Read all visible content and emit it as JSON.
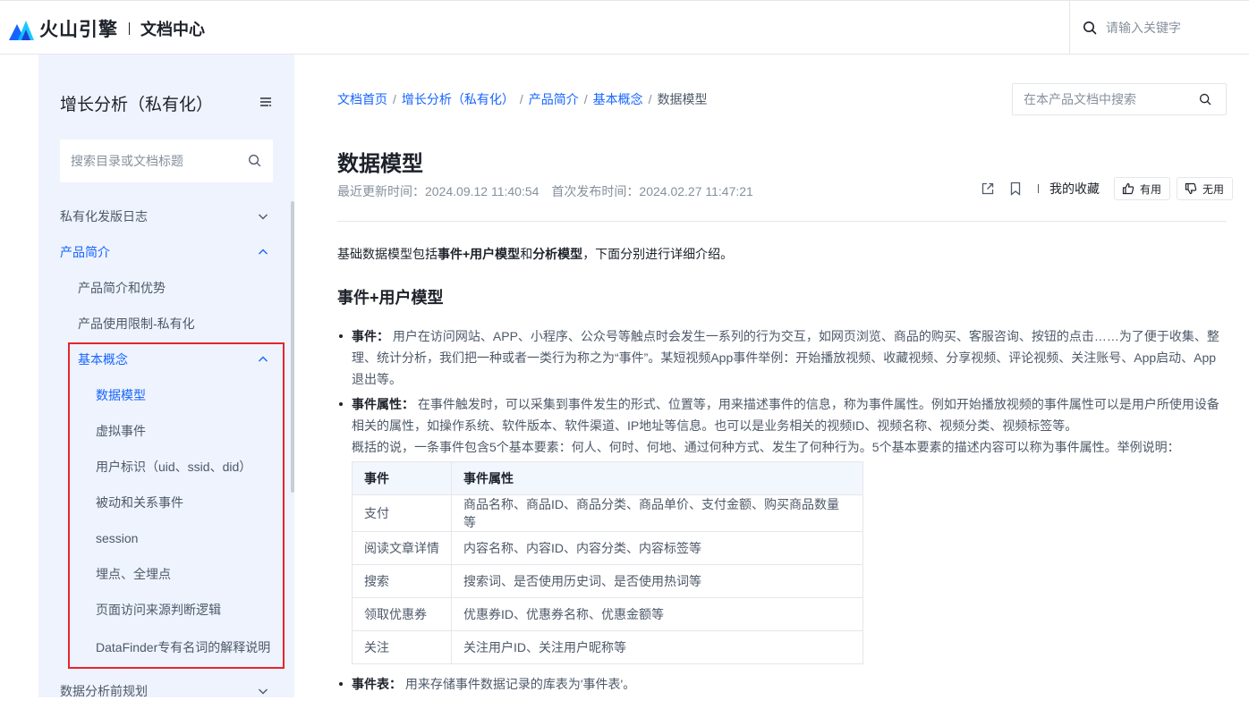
{
  "header": {
    "brand": "火山引擎",
    "section": "文档中心",
    "search_placeholder": "请输入关键字"
  },
  "sidebar": {
    "title": "增长分析（私有化）",
    "search_placeholder": "搜索目录或文档标题",
    "items": [
      {
        "label": "私有化发版日志"
      },
      {
        "label": "产品简介"
      },
      {
        "label": "产品简介和优势"
      },
      {
        "label": "产品使用限制-私有化"
      },
      {
        "label": "基本概念"
      },
      {
        "label": "数据模型"
      },
      {
        "label": "虚拟事件"
      },
      {
        "label": "用户标识（uid、ssid、did）"
      },
      {
        "label": "被动和关系事件"
      },
      {
        "label": "session"
      },
      {
        "label": "埋点、全埋点"
      },
      {
        "label": "页面访问来源判断逻辑"
      },
      {
        "label": "DataFinder专有名词的解释说明"
      },
      {
        "label": "数据分析前规划"
      }
    ]
  },
  "breadcrumb": {
    "items": [
      "文档首页",
      "增长分析（私有化）",
      "产品简介",
      "基本概念"
    ],
    "current": "数据模型"
  },
  "content_search_placeholder": "在本产品文档中搜索",
  "article": {
    "title": "数据模型",
    "updated": "最近更新时间：2024.09.12 11:40:54",
    "published": "首次发布时间：2024.02.27 11:47:21",
    "favorite_label": "我的收藏",
    "useful_label": "有用",
    "useless_label": "无用",
    "intro_prefix": "基础数据模型包括",
    "intro_bold1": "事件+用户模型",
    "intro_mid": "和",
    "intro_bold2": "分析模型",
    "intro_suffix": "，下面分别进行详细介绍。",
    "section_heading": "事件+用户模型",
    "bullet1_term": "事件：",
    "bullet1_text": " 用户在访问网站、APP、小程序、公众号等触点时会发生一系列的行为交互，如网页浏览、商品的购买、客服咨询、按钮的点击……为了便于收集、整理、统计分析，我们把一种或者一类行为称之为“事件”。某短视频App事件举例：开始播放视频、收藏视频、分享视频、评论视频、关注账号、App启动、App退出等。",
    "bullet2_term": "事件属性：",
    "bullet2_text": " 在事件触发时，可以采集到事件发生的形式、位置等，用来描述事件的信息，称为事件属性。例如开始播放视频的事件属性可以是用户所使用设备相关的属性，如操作系统、软件版本、软件渠道、IP地址等信息。也可以是业务相关的视频ID、视频名称、视频分类、视频标签等。",
    "bullet2_extra": "概括的说，一条事件包含5个基本要素：何人、何时、何地、通过何种方式、发生了何种行为。5个基本要素的描述内容可以称为事件属性。举例说明：",
    "table": {
      "headers": [
        "事件",
        "事件属性"
      ],
      "rows": [
        [
          "支付",
          "商品名称、商品ID、商品分类、商品单价、支付金额、购买商品数量等"
        ],
        [
          "阅读文章详情",
          "内容名称、内容ID、内容分类、内容标签等"
        ],
        [
          "搜索",
          "搜索词、是否使用历史词、是否使用热词等"
        ],
        [
          "领取优惠券",
          "优惠券ID、优惠券名称、优惠金额等"
        ],
        [
          "关注",
          "关注用户ID、关注用户昵称等"
        ]
      ]
    },
    "bullet3_term": "事件表：",
    "bullet3_text": " 用来存储事件数据记录的库表为'事件表'。"
  },
  "colors": {
    "accent": "#1664ff",
    "sidebar_bg": "#eef3fd",
    "highlight_border": "#e5262f"
  }
}
